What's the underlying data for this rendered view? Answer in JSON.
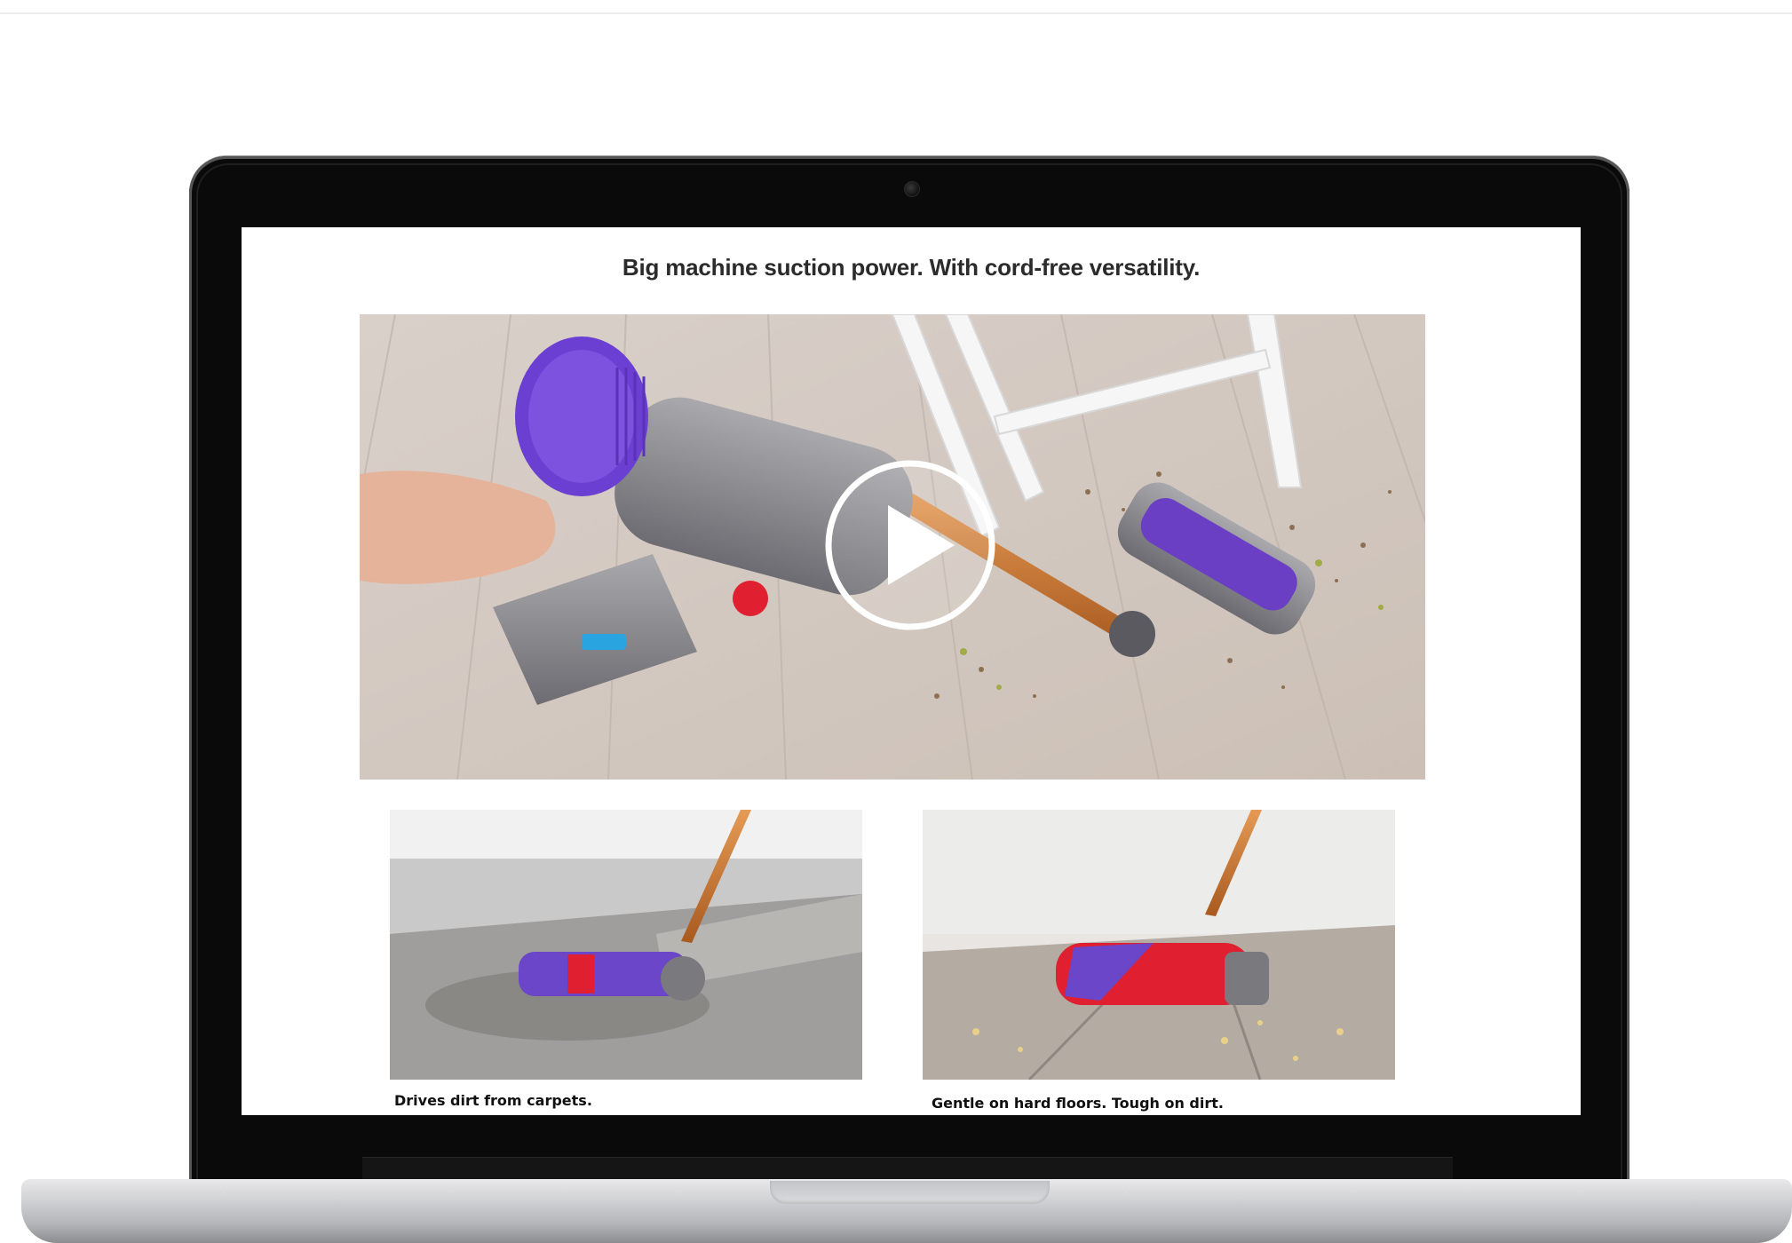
{
  "page": {
    "headline": "Big machine suction power. With cord-free versatility."
  },
  "hero_video": {
    "play_icon": "play-circle-icon"
  },
  "features": [
    {
      "caption": "Drives dirt from carpets."
    },
    {
      "caption": "Gentle on hard floors. Tough on dirt."
    }
  ],
  "colors": {
    "vacuum_purple": "#7a4fd0",
    "wand_copper": "#c9732e",
    "accent_red": "#e02030",
    "bezel": "#0a0a0a"
  }
}
